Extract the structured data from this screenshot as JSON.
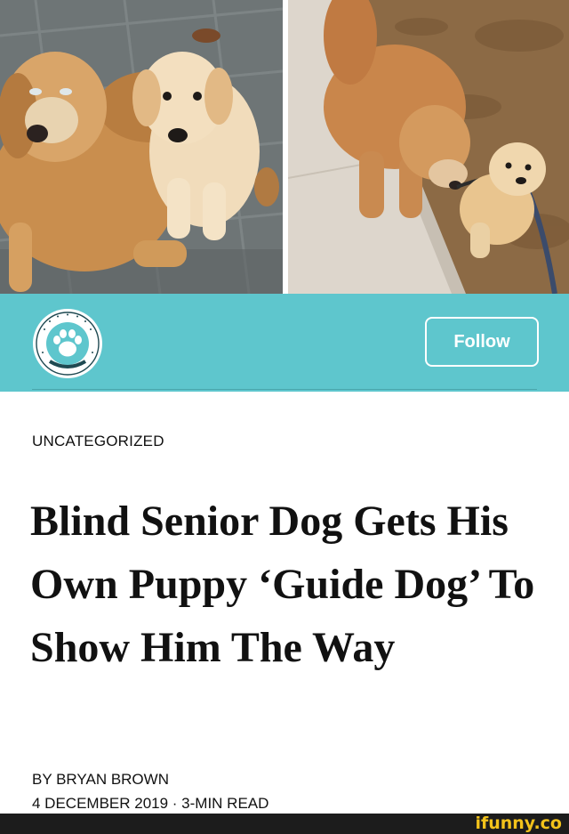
{
  "photos": {
    "left": {
      "icon": "golden-retriever-with-puppy-photo"
    },
    "right": {
      "icon": "puppy-leading-senior-dog-photo"
    }
  },
  "header": {
    "logo_icon": "paw-badge-icon",
    "follow_label": "Follow",
    "accent_color": "#5ec6cd"
  },
  "article": {
    "category": "UNCATEGORIZED",
    "title": "Blind Senior Dog Gets His Own Puppy ‘Guide Dog’ To Show Him The Way",
    "author": "BY BRYAN BROWN",
    "meta": "4 DECEMBER 2019 · 3-MIN READ"
  },
  "watermark": {
    "text": "ifunny.co",
    "color": "#f2c21b"
  }
}
